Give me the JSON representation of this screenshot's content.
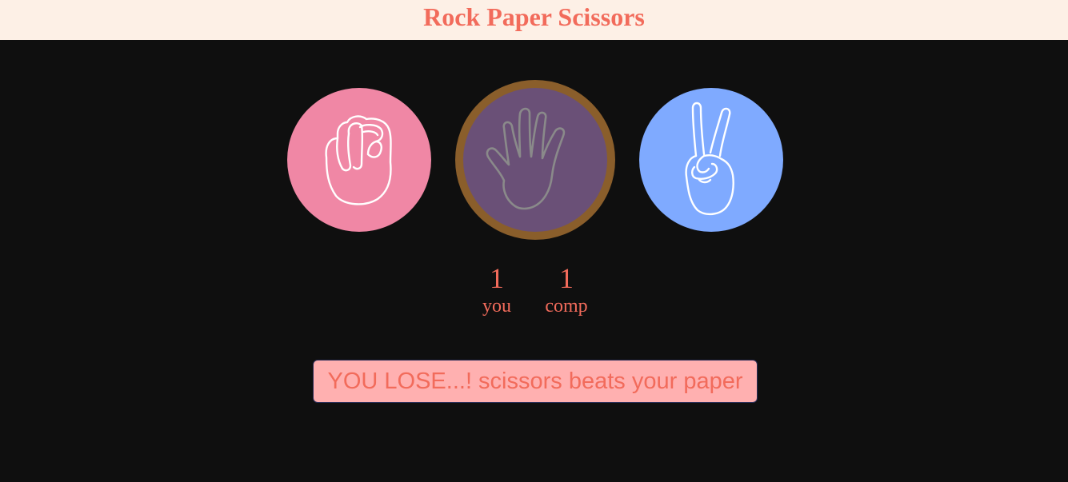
{
  "header": {
    "title": "Rock Paper Scissors"
  },
  "choices": [
    {
      "name": "rock",
      "icon": "fist-icon",
      "color": "#f087a5"
    },
    {
      "name": "paper",
      "icon": "open-hand-icon",
      "color": "#6a5077",
      "ring_color": "#8a5e2b",
      "selected": true
    },
    {
      "name": "scissors",
      "icon": "peace-sign-icon",
      "color": "#7faaff"
    }
  ],
  "scores": {
    "user": {
      "value": "1",
      "label": "you"
    },
    "comp": {
      "value": "1",
      "label": "comp"
    }
  },
  "result": {
    "message": "YOU LOSE...! scissors beats your paper",
    "background": "#ffb0b0",
    "text_color": "#f26b5b"
  }
}
